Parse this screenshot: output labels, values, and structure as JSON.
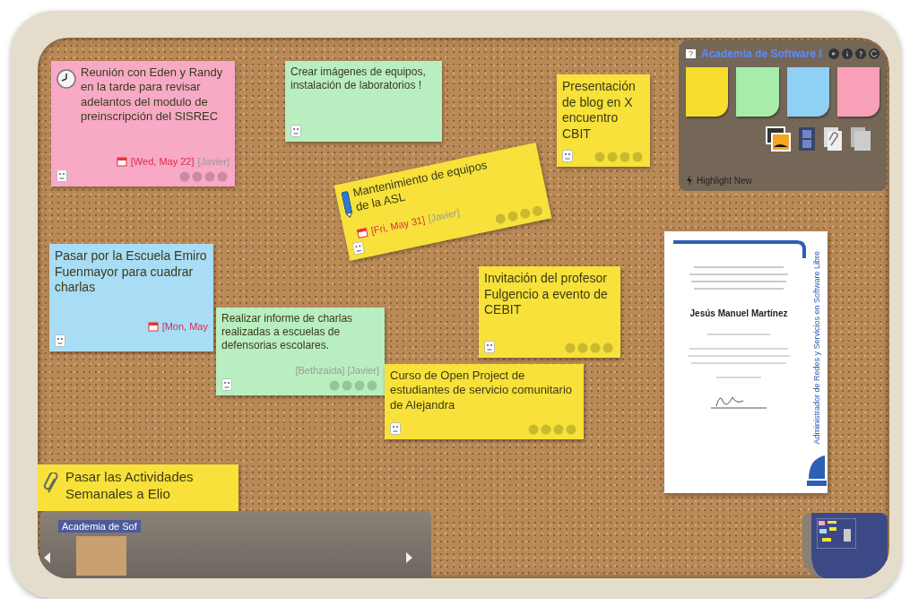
{
  "notes": [
    {
      "color": "#f7a9c6",
      "text": "Reunión con Eden y Randy en la tarde para revisar adelantos del modulo de preinscripción del SISREC",
      "date": "[Wed, May 22]",
      "people": "[Javier]"
    },
    {
      "color": "#b9efc0",
      "text": "Crear imágenes de equipos, instalación de laboratorios !"
    },
    {
      "color": "#f7e13a",
      "text": "Mantenimiento de equipos de la ASL",
      "date": "[Fri, May 31]",
      "people": "[Javier]"
    },
    {
      "color": "#f7e13a",
      "text": "Presentación de blog en X encuentro CBIT"
    },
    {
      "color": "#a9dcf5",
      "text": "Pasar por la Escuela Emiro Fuenmayor para cuadrar charlas",
      "date": "[Mon, May"
    },
    {
      "color": "#b9efc0",
      "text": "Realizar informe de charlas realizadas a escuelas de defensorias escolares.",
      "people": "[Bethzaida] [Javier]"
    },
    {
      "color": "#f7e13a",
      "text": "Invitación del profesor Fulgencio a evento de CEBIT"
    },
    {
      "color": "#f7e13a",
      "text": "Curso de Open Project de estudiantes de servicio comunitario de Alejandra"
    },
    {
      "color": "#f7e13a",
      "text": "Pasar las Actividades Semanales a Elio"
    }
  ],
  "certificate": {
    "name": "Jesús Manuel Martínez",
    "title": "Administrador de Redes y Servicios en Software Libre"
  },
  "toolbox": {
    "help_label": "?",
    "title": "Academia de Software l",
    "pads": [
      {
        "color": "#f7dd2c"
      },
      {
        "color": "#a8ecaa"
      },
      {
        "color": "#8fd0f5"
      },
      {
        "color": "#f7a0b8"
      }
    ],
    "highlight": "Highlight New"
  },
  "board_bar": {
    "tab": "Academia de Sof"
  }
}
